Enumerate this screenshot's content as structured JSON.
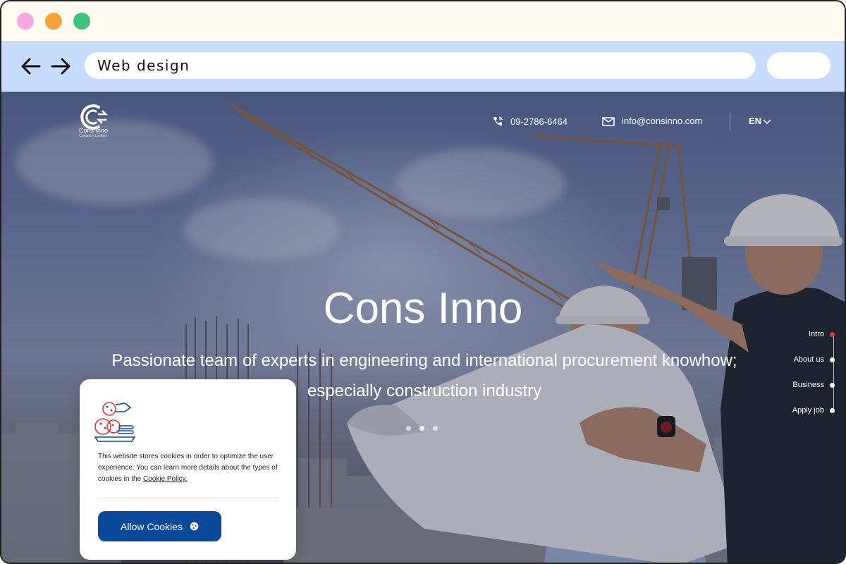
{
  "browser": {
    "address_text": "Web design"
  },
  "header": {
    "logo_name": "Cons Inno",
    "logo_sub": "Company Limited",
    "phone": "09-2786-6464",
    "email": "info@consinno.com",
    "language": "EN"
  },
  "hero": {
    "title": "Cons Inno",
    "subtitle": "Passionate team of experts in engineering and international procurement knowhow; especially construction industry",
    "slides_total": 3,
    "active_slide": 2
  },
  "side_nav": {
    "items": [
      {
        "label": "Intro",
        "active": true
      },
      {
        "label": "About us",
        "active": false
      },
      {
        "label": "Business",
        "active": false
      },
      {
        "label": "Apply job",
        "active": false
      }
    ]
  },
  "cookie_notice": {
    "text": "This website stores cookies in order to optimize the user experience. You can learn more details about the types of cookies in the ",
    "link_text": "Cookie Policy.",
    "button_label": "Allow Cookies"
  },
  "colors": {
    "toolbar_bg": "#c7dcfa",
    "titlebar_bg": "#fffaf0",
    "accent_button": "#0b4a9b",
    "active_nav_dot": "#e5313c",
    "traffic_pink": "#f9a8e0",
    "traffic_orange": "#f7a23a",
    "traffic_green": "#3cc47c"
  }
}
